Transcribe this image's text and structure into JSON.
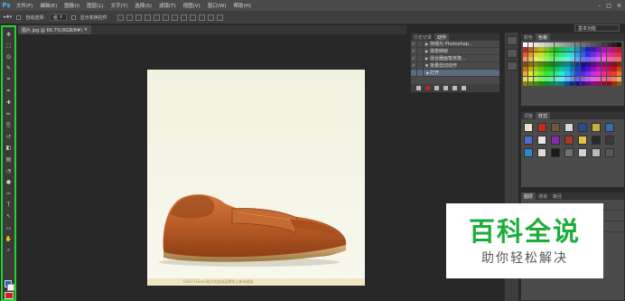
{
  "app": {
    "logo": "Ps"
  },
  "menu": [
    "文件(F)",
    "编辑(E)",
    "图像(I)",
    "图层(L)",
    "文字(Y)",
    "选择(S)",
    "滤镜(T)",
    "视图(V)",
    "窗口(W)",
    "帮助(H)"
  ],
  "window_controls": [
    "–",
    "□",
    "✕"
  ],
  "options": {
    "auto_select_label": "自动选择:",
    "auto_select_value": "组",
    "show_transform_label": "显示变换控件",
    "workspace": "基本功能"
  },
  "document": {
    "tab_title": "图片.jpg @ 66.7%(RGB/8#)"
  },
  "canvas": {
    "caption": "GUCCI   Gucci意大利皮具品牌男士休闲皮鞋"
  },
  "actions_panel": {
    "tabs": [
      "历史记录",
      "动作"
    ],
    "rows": [
      {
        "label": "存储为 Photoshop...",
        "checked": true
      },
      {
        "label": "渐变映射",
        "checked": true
      },
      {
        "label": "混合器画笔克隆...",
        "checked": true
      },
      {
        "label": "批量剪切动作",
        "checked": true
      },
      {
        "label": "打开",
        "checked": false,
        "selected": true
      }
    ]
  },
  "swatches_panel": {
    "tabs": [
      "颜色",
      "色板"
    ]
  },
  "styles_panel": {
    "tabs": [
      "调整",
      "样式"
    ]
  },
  "layers_panel": {
    "tabs": [
      "图层",
      "通道",
      "路径"
    ]
  },
  "toolbox": {
    "tools": [
      "move-icon",
      "marquee-icon",
      "lasso-icon",
      "quick-select-icon",
      "crop-icon",
      "eyedropper-icon",
      "healing-icon",
      "brush-icon",
      "clone-stamp-icon",
      "history-brush-icon",
      "eraser-icon",
      "gradient-icon",
      "blur-icon",
      "dodge-icon",
      "pen-icon",
      "type-icon",
      "path-select-icon",
      "shape-icon",
      "hand-icon",
      "zoom-icon"
    ],
    "glyphs": [
      "✥",
      "⬚",
      "ʘ",
      "✎",
      "⌗",
      "✒",
      "✚",
      "✏",
      "⎘",
      "↺",
      "◧",
      "▤",
      "◔",
      "●",
      "✑",
      "T",
      "↖",
      "▭",
      "✋",
      "⌕"
    ],
    "foreground_color": "#1d62c8",
    "background_color": "#f2f2f2"
  },
  "watermark": {
    "title": "百科全说",
    "subtitle": "助你轻松解决",
    "color": "#1cae3a"
  },
  "highlight_color": "#21d52c"
}
